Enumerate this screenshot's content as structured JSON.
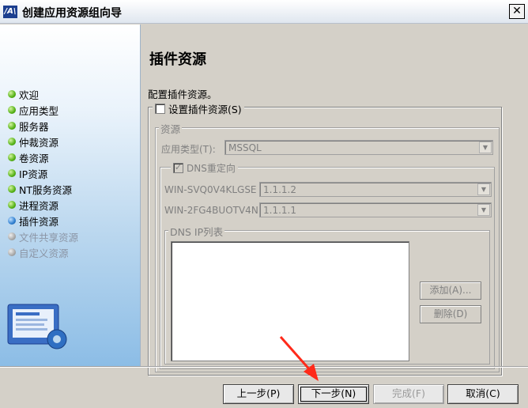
{
  "window": {
    "title": "创建应用资源组向导",
    "logo": "/A\\",
    "close_glyph": "✕"
  },
  "sidebar": {
    "steps": [
      {
        "label": "欢迎",
        "state": "done"
      },
      {
        "label": "应用类型",
        "state": "done"
      },
      {
        "label": "服务器",
        "state": "done"
      },
      {
        "label": "仲裁资源",
        "state": "done"
      },
      {
        "label": "卷资源",
        "state": "done"
      },
      {
        "label": "IP资源",
        "state": "done"
      },
      {
        "label": "NT服务资源",
        "state": "done"
      },
      {
        "label": "进程资源",
        "state": "done"
      },
      {
        "label": "插件资源",
        "state": "current"
      },
      {
        "label": "文件共享资源",
        "state": "future"
      },
      {
        "label": "自定义资源",
        "state": "future"
      }
    ]
  },
  "main": {
    "title": "插件资源",
    "description": "配置插件资源。",
    "configure_checkbox": {
      "label": "设置插件资源(S)",
      "checked": false
    },
    "resource_group": {
      "label": "资源",
      "app_type_label": "应用类型(T):",
      "app_type_value": "MSSQL",
      "dns_checkbox": {
        "label": "DNS重定向",
        "checked": true
      },
      "hosts": [
        {
          "name": "WIN-SVQ0V4KLGSE",
          "ip": "1.1.1.2"
        },
        {
          "name": "WIN-2FG4BUOTV4N",
          "ip": "1.1.1.1"
        }
      ],
      "dns_ip_list_label": "DNS IP列表",
      "add_label": "添加(A)...",
      "delete_label": "删除(D)"
    }
  },
  "footer": {
    "prev_label": "上一步(P)",
    "next_label": "下一步(N)",
    "finish_label": "完成(F)",
    "cancel_label": "取消(C)"
  },
  "colors": {
    "annotation_arrow": "#ff2a1a",
    "done_dot": "#55b216",
    "current_dot": "#2f7fd0"
  }
}
